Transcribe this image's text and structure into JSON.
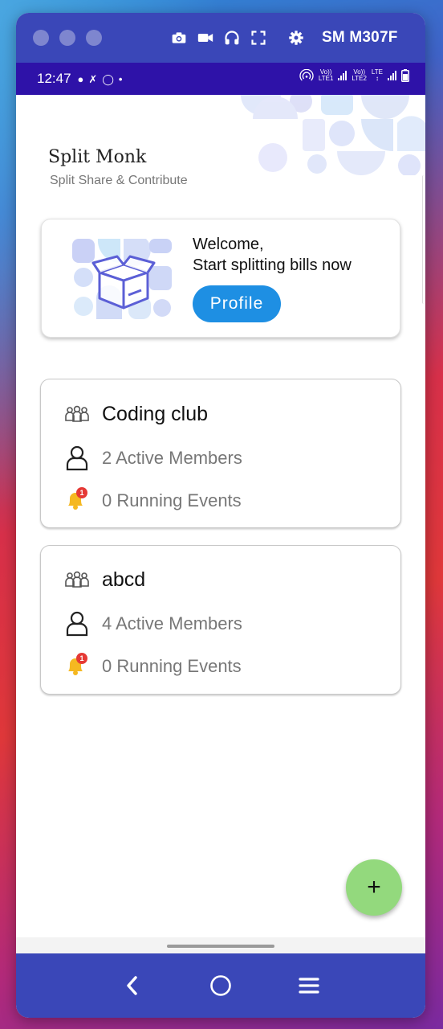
{
  "emulator": {
    "model": "SM M307F",
    "tools": [
      "camera-icon",
      "video-icon",
      "headphones-icon",
      "fullscreen-icon",
      "settings-icon"
    ]
  },
  "status_bar": {
    "time": "12:47",
    "sim1_label_top": "Vo))",
    "sim1_label_bottom": "LTE1",
    "sim2_label_top": "Vo))",
    "sim2_label_bottom": "LTE2",
    "network_label": "LTE"
  },
  "app": {
    "title": "Split Monk",
    "subtitle": "Split Share & Contribute",
    "welcome": {
      "line1": "Welcome,",
      "line2": "Start splitting bills now",
      "profile_button": "Profile"
    },
    "groups": [
      {
        "name": "Coding club",
        "members": "2 Active Members",
        "events": "0 Running Events",
        "badge": "1"
      },
      {
        "name": "abcd",
        "members": "4 Active Members",
        "events": "0 Running Events",
        "badge": "1"
      }
    ],
    "fab_label": "+"
  },
  "colors": {
    "emulator_bar": "#3a47b8",
    "status_bar": "#2e12a8",
    "profile_button": "#1e8fe3",
    "fab": "#93d97d"
  }
}
